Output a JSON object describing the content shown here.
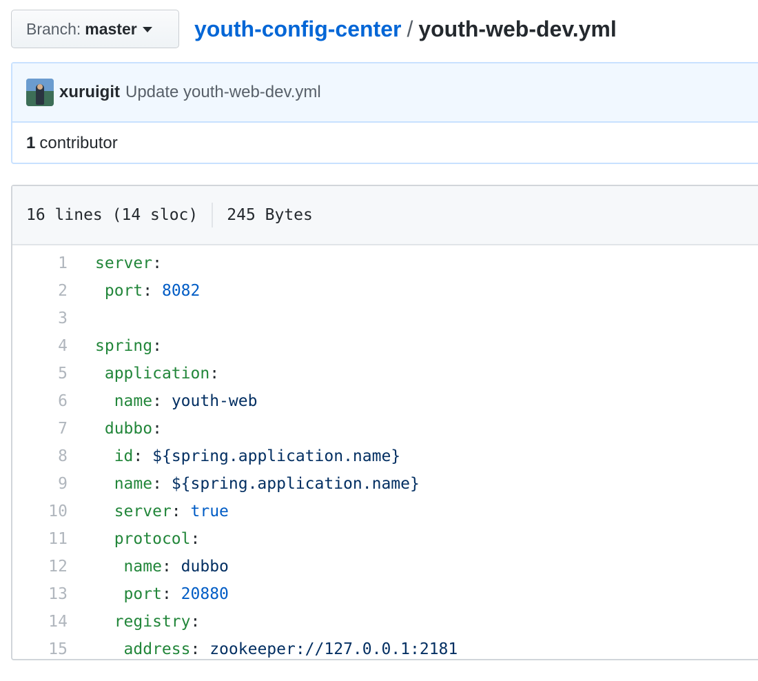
{
  "branch": {
    "label": "Branch:",
    "value": "master"
  },
  "breadcrumb": {
    "repo": "youth-config-center",
    "separator": "/",
    "file": "youth-web-dev.yml"
  },
  "commit": {
    "author": "xuruigit",
    "message": "Update youth-web-dev.yml",
    "contributors_count": "1",
    "contributors_label": "contributor"
  },
  "file_info": {
    "lines": "16 lines (14 sloc)",
    "size": "245 Bytes"
  },
  "code_lines": [
    {
      "n": "1",
      "indent": "",
      "key": "server",
      "value": "",
      "vtype": ""
    },
    {
      "n": "2",
      "indent": " ",
      "key": "port",
      "value": "8082",
      "vtype": "num"
    },
    {
      "n": "3",
      "indent": "",
      "key": "",
      "value": "",
      "vtype": ""
    },
    {
      "n": "4",
      "indent": "",
      "key": "spring",
      "value": "",
      "vtype": ""
    },
    {
      "n": "5",
      "indent": " ",
      "key": "application",
      "value": "",
      "vtype": ""
    },
    {
      "n": "6",
      "indent": "  ",
      "key": "name",
      "value": "youth-web",
      "vtype": "str"
    },
    {
      "n": "7",
      "indent": " ",
      "key": "dubbo",
      "value": "",
      "vtype": ""
    },
    {
      "n": "8",
      "indent": "  ",
      "key": "id",
      "value": "${spring.application.name}",
      "vtype": "str"
    },
    {
      "n": "9",
      "indent": "  ",
      "key": "name",
      "value": "${spring.application.name}",
      "vtype": "str"
    },
    {
      "n": "10",
      "indent": "  ",
      "key": "server",
      "value": "true",
      "vtype": "num"
    },
    {
      "n": "11",
      "indent": "  ",
      "key": "protocol",
      "value": "",
      "vtype": ""
    },
    {
      "n": "12",
      "indent": "   ",
      "key": "name",
      "value": "dubbo",
      "vtype": "str"
    },
    {
      "n": "13",
      "indent": "   ",
      "key": "port",
      "value": "20880",
      "vtype": "num"
    },
    {
      "n": "14",
      "indent": "  ",
      "key": "registry",
      "value": "",
      "vtype": ""
    },
    {
      "n": "15",
      "indent": "   ",
      "key": "address",
      "value": "zookeeper://127.0.0.1:2181",
      "vtype": "str"
    }
  ],
  "colors": {
    "link": "#0366d6",
    "yaml_key": "#22863a",
    "yaml_number": "#005cc5",
    "yaml_string": "#032f62",
    "commit_bg": "#f1f8ff"
  }
}
